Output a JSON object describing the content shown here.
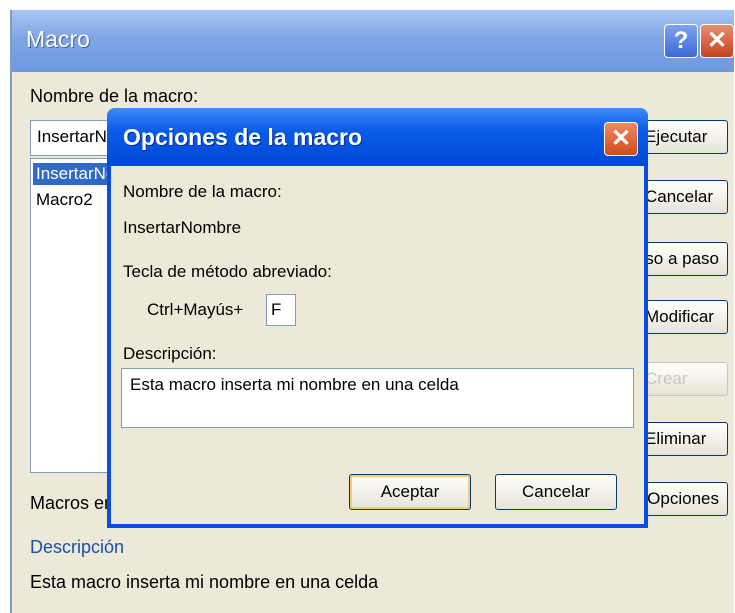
{
  "macro_window": {
    "title": "Macro",
    "help_glyph": "?",
    "close_glyph": "✕",
    "macro_name_label": "Nombre de la macro:",
    "macro_name_value": "InsertarNombre",
    "macro_list": [
      "InsertarNombre",
      "Macro2"
    ],
    "side_buttons": [
      {
        "label": "Ejecutar",
        "enabled": true
      },
      {
        "label": "Cancelar",
        "enabled": true
      },
      {
        "label": "Paso a paso",
        "enabled": true
      },
      {
        "label": "Modificar",
        "enabled": true
      },
      {
        "label": "Crear",
        "enabled": false
      },
      {
        "label": "Eliminar",
        "enabled": true
      },
      {
        "label": "Opciones...",
        "enabled": true
      }
    ],
    "macros_in_label": "Macros en:",
    "description_label": "Descripción",
    "description_text": "Esta macro inserta mi nombre en una celda"
  },
  "options_dialog": {
    "title": "Opciones de la macro",
    "close_glyph": "✕",
    "macro_name_label": "Nombre de la macro:",
    "macro_name": "InsertarNombre",
    "shortcut_label": "Tecla de método abreviado:",
    "shortcut_prefix": "Ctrl+Mayús+",
    "shortcut_key": "F",
    "description_label": "Descripción:",
    "description_value": "Esta macro inserta mi nombre en una celda",
    "ok_label": "Aceptar",
    "cancel_label": "Cancelar"
  },
  "colors": {
    "title_active": "#0a4ee0",
    "title_inactive": "#7fa6e6",
    "dialog_bg": "#ece9d8",
    "selection": "#316ac5",
    "close_red": "#d24a1b"
  },
  "icons": {
    "help": "help-icon",
    "close": "close-icon"
  }
}
